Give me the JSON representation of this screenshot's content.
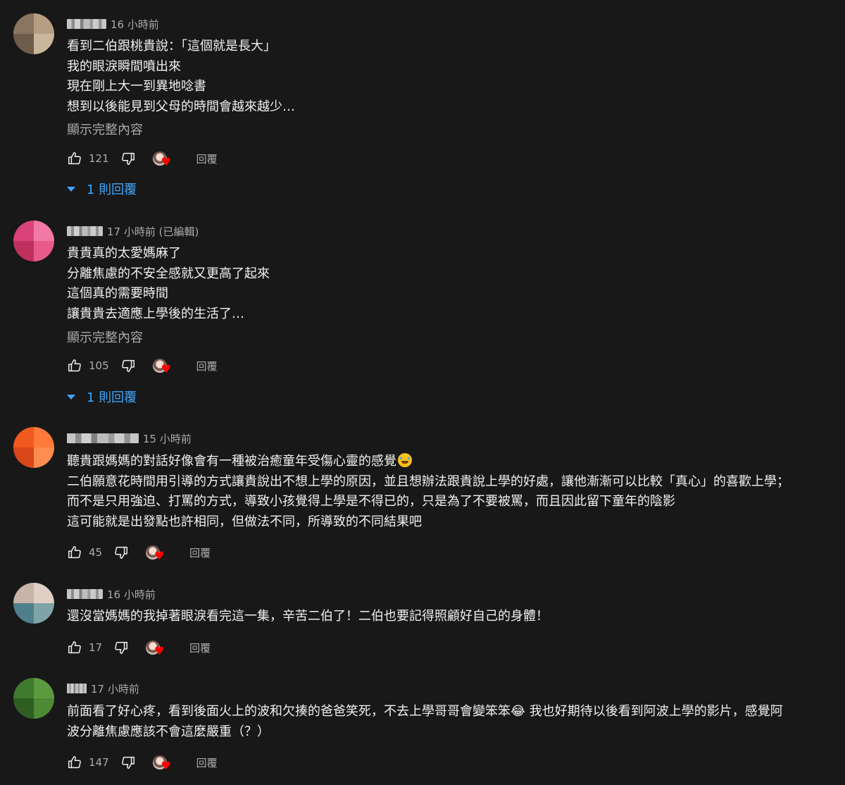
{
  "comments": [
    {
      "time": "16 小時前",
      "lines": [
        "看到二伯跟桃貴說：「這個就是長大」",
        "我的眼淚瞬間噴出來",
        "現在剛上大一到異地唸書",
        "想到以後能見到父母的時間會越來越少…"
      ],
      "show_more": "顯示完整內容",
      "likes": "121",
      "reply_label": "回覆",
      "replies_toggle": "1 則回覆",
      "avatar_colors": [
        "#8a7560",
        "#b59e82",
        "#6e5c4a",
        "#c9b79c"
      ]
    },
    {
      "time": "17 小時前 (已編輯)",
      "lines": [
        "貴貴真的太愛媽麻了",
        "分離焦慮的不安全感就又更高了起來",
        "這個真的需要時間",
        "讓貴貴去適應上學後的生活了…"
      ],
      "show_more": "顯示完整內容",
      "likes": "105",
      "reply_label": "回覆",
      "replies_toggle": "1 則回覆",
      "avatar_colors": [
        "#d9437a",
        "#f07aa3",
        "#c0305f",
        "#e85a8c"
      ]
    },
    {
      "time": "15 小時前",
      "lines": [
        "聽貴跟媽媽的對話好像會有一種被治癒童年受傷心靈的感覺",
        "二伯願意花時間用引導的方式讓貴說出不想上學的原因，並且想辦法跟貴說上學的好處，讓他漸漸可以比較「真心」的喜歡上學；",
        "而不是只用強迫、打罵的方式，導致小孩覺得上學是不得已的，只是為了不要被罵，而且因此留下童年的陰影",
        "這可能就是出發點也許相同，但做法不同，所導致的不同結果吧"
      ],
      "likes": "45",
      "reply_label": "回覆",
      "avatar_colors": [
        "#f05a20",
        "#ff7a3a",
        "#d8481a",
        "#ff8c50"
      ]
    },
    {
      "time": "16 小時前",
      "lines": [
        "還沒當媽媽的我掉著眼淚看完這一集，辛苦二伯了！二伯也要記得照顧好自己的身體！"
      ],
      "likes": "17",
      "reply_label": "回覆",
      "avatar_colors": [
        "#c8b4a8",
        "#7fa3a8",
        "#e0cfc4",
        "#4f7f8a"
      ]
    },
    {
      "time": "17 小時前",
      "lines": [
        "前面看了好心疼，看到後面火上的波和欠揍的爸爸笑死，不去上學哥哥會變笨笨😂 我也好期待以後看到阿波上學的影片，感覺阿",
        "波分離焦慮應該不會這麼嚴重（？）"
      ],
      "likes": "147",
      "reply_label": "回覆",
      "avatar_colors": [
        "#3f7a2e",
        "#5c9a40",
        "#2e5e22",
        "#4d8a35"
      ]
    }
  ]
}
